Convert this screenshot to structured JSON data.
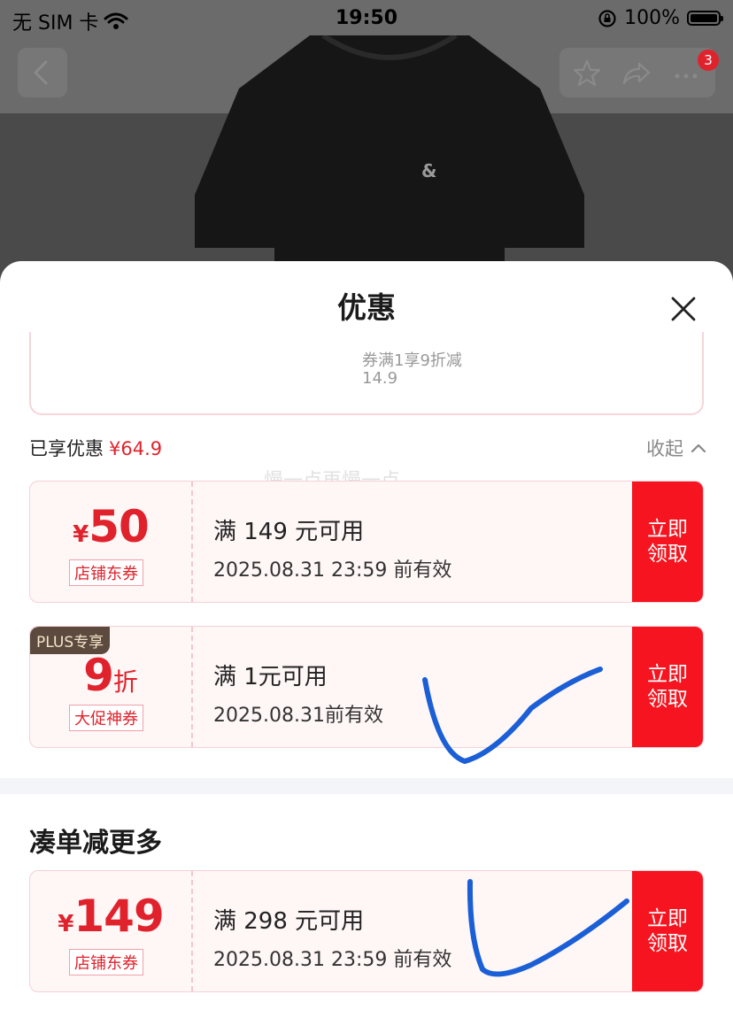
{
  "status_bar": {
    "carrier": "无 SIM 卡",
    "time": "19:50",
    "battery": "100%"
  },
  "header": {
    "badge_count": "3",
    "shirt_logo": "&"
  },
  "sheet": {
    "title": "优惠",
    "previous_card": {
      "line1": "券满1享9折减",
      "line2": "14.9"
    },
    "enjoyed": {
      "label": "已享优惠",
      "amount": "¥64.9"
    },
    "collapse_label": "收起",
    "watermark": "慢一点再慢一点",
    "coupons": [
      {
        "currency": "¥",
        "value": "50",
        "tag": "店铺东券",
        "condition": "满 149 元可用",
        "valid": "2025.08.31 23:59 前有效",
        "claim": "立即领取"
      },
      {
        "plus_tag": "PLUS专享",
        "value": "9",
        "unit": "折",
        "tag": "大促神券",
        "condition": "满 1元可用",
        "valid": "2025.08.31前有效",
        "claim": "立即领取"
      }
    ],
    "more_section": {
      "title": "凑单减更多",
      "coupons": [
        {
          "currency": "¥",
          "value": "149",
          "tag": "店铺东券",
          "condition": "满 298 元可用",
          "valid": "2025.08.31 23:59 前有效",
          "claim": "立即领取"
        }
      ]
    }
  },
  "colors": {
    "accent": "#f5141f",
    "price_red": "#e0222c",
    "annotation_blue": "#1a5fd6"
  }
}
